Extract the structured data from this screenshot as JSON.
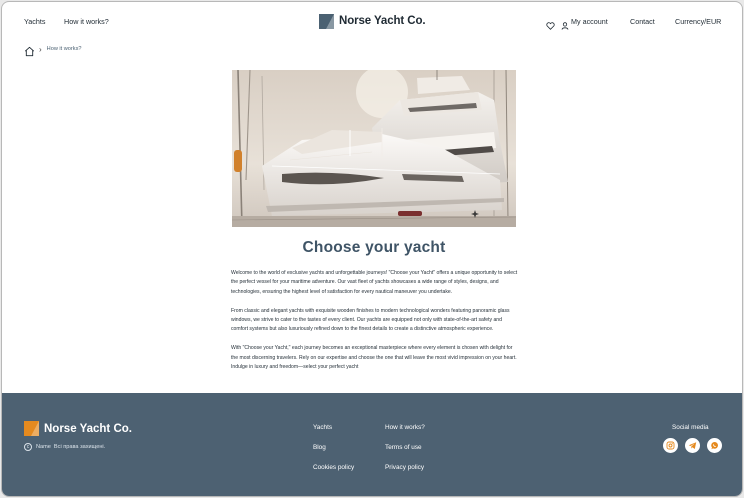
{
  "header": {
    "nav_left": [
      "Yachts",
      "How it works?"
    ],
    "brand": "Norse Yacht Co.",
    "account_label": "My account",
    "contact_label": "Contact",
    "currency_label": "Currency/EUR"
  },
  "breadcrumb": {
    "current": "How it works?"
  },
  "main": {
    "title": "Choose your yacht",
    "paragraphs": [
      "Welcome to the world of exclusive yachts and unforgettable journeys! \"Choose your Yacht\" offers a unique opportunity to select the perfect vessel for your maritime adventure. Our vast fleet of yachts showcases a wide range of styles, designs, and technologies, ensuring the highest level of satisfaction for every nautical maneuver you undertake.",
      "From classic and elegant yachts with exquisite wooden finishes to modern technological wonders featuring panoramic glass windows, we strive to cater to the tastes of every client. Our yachts are equipped not only with state-of-the-art safety and comfort systems but also luxuriously refined down to the finest details to create a distinctive atmospheric experience.",
      "With \"Choose your Yacht,\" each journey becomes an exceptional masterpiece where every element is chosen with delight for the most discerning travelers. Rely on our expertise and choose the one that will leave the most vivid impression on your heart. Indulge in luxury and freedom—select your perfect yacht"
    ]
  },
  "footer": {
    "brand": "Norse Yacht Co.",
    "copyright_name": "Name",
    "copyright_text": "Всі права захищені.",
    "links_col1": [
      "Yachts",
      "Blog",
      "Cookies policy"
    ],
    "links_col2": [
      "How it works?",
      "Terms of use",
      "Privacy policy"
    ],
    "social_label": "Social media",
    "social_icons": [
      "instagram-icon",
      "telegram-icon",
      "whatsapp-icon"
    ]
  },
  "colors": {
    "accent": "#e58a1f",
    "footer_bg": "#4d6172",
    "title": "#3f5466",
    "brand_mark": "#4b6172"
  }
}
